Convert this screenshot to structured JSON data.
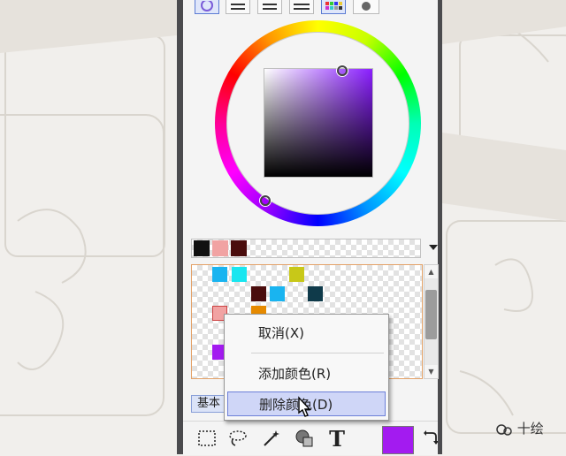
{
  "context_menu": {
    "items": [
      {
        "label": "取消(X)"
      },
      {
        "label": "添加颜色(R)"
      },
      {
        "label": "删除颜色(D)"
      }
    ]
  },
  "tab": {
    "label": "基本"
  },
  "tools": {
    "text_tool_glyph": "T"
  },
  "watermark": {
    "text": "十绘"
  },
  "colors": {
    "foreground": "#a31bf0",
    "picker_hue": "#8a1eff",
    "strip_swatches": [
      "#111111",
      "#f1a3a3",
      "#4a0d0d"
    ],
    "grid_swatches": [
      "#19b4f0",
      "#19e6f0",
      "#c8c818",
      "#4a0d0d",
      "#19b4f0",
      "#0f3a4a",
      "#f1a3a3",
      "#e68a00",
      "#a31bf0"
    ]
  }
}
